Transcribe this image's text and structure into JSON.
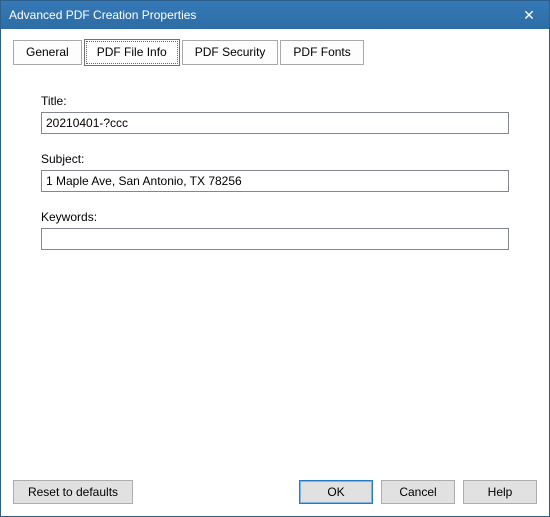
{
  "window": {
    "title": "Advanced PDF Creation Properties",
    "close_glyph": "✕"
  },
  "tabs": {
    "general": "General",
    "file_info": "PDF File Info",
    "security": "PDF Security",
    "fonts": "PDF Fonts"
  },
  "fields": {
    "title_label": "Title:",
    "title_value": "20210401-?ccc",
    "subject_label": "Subject:",
    "subject_value": "1 Maple Ave, San Antonio, TX 78256",
    "keywords_label": "Keywords:",
    "keywords_value": ""
  },
  "buttons": {
    "reset": "Reset to defaults",
    "ok": "OK",
    "cancel": "Cancel",
    "help": "Help"
  }
}
